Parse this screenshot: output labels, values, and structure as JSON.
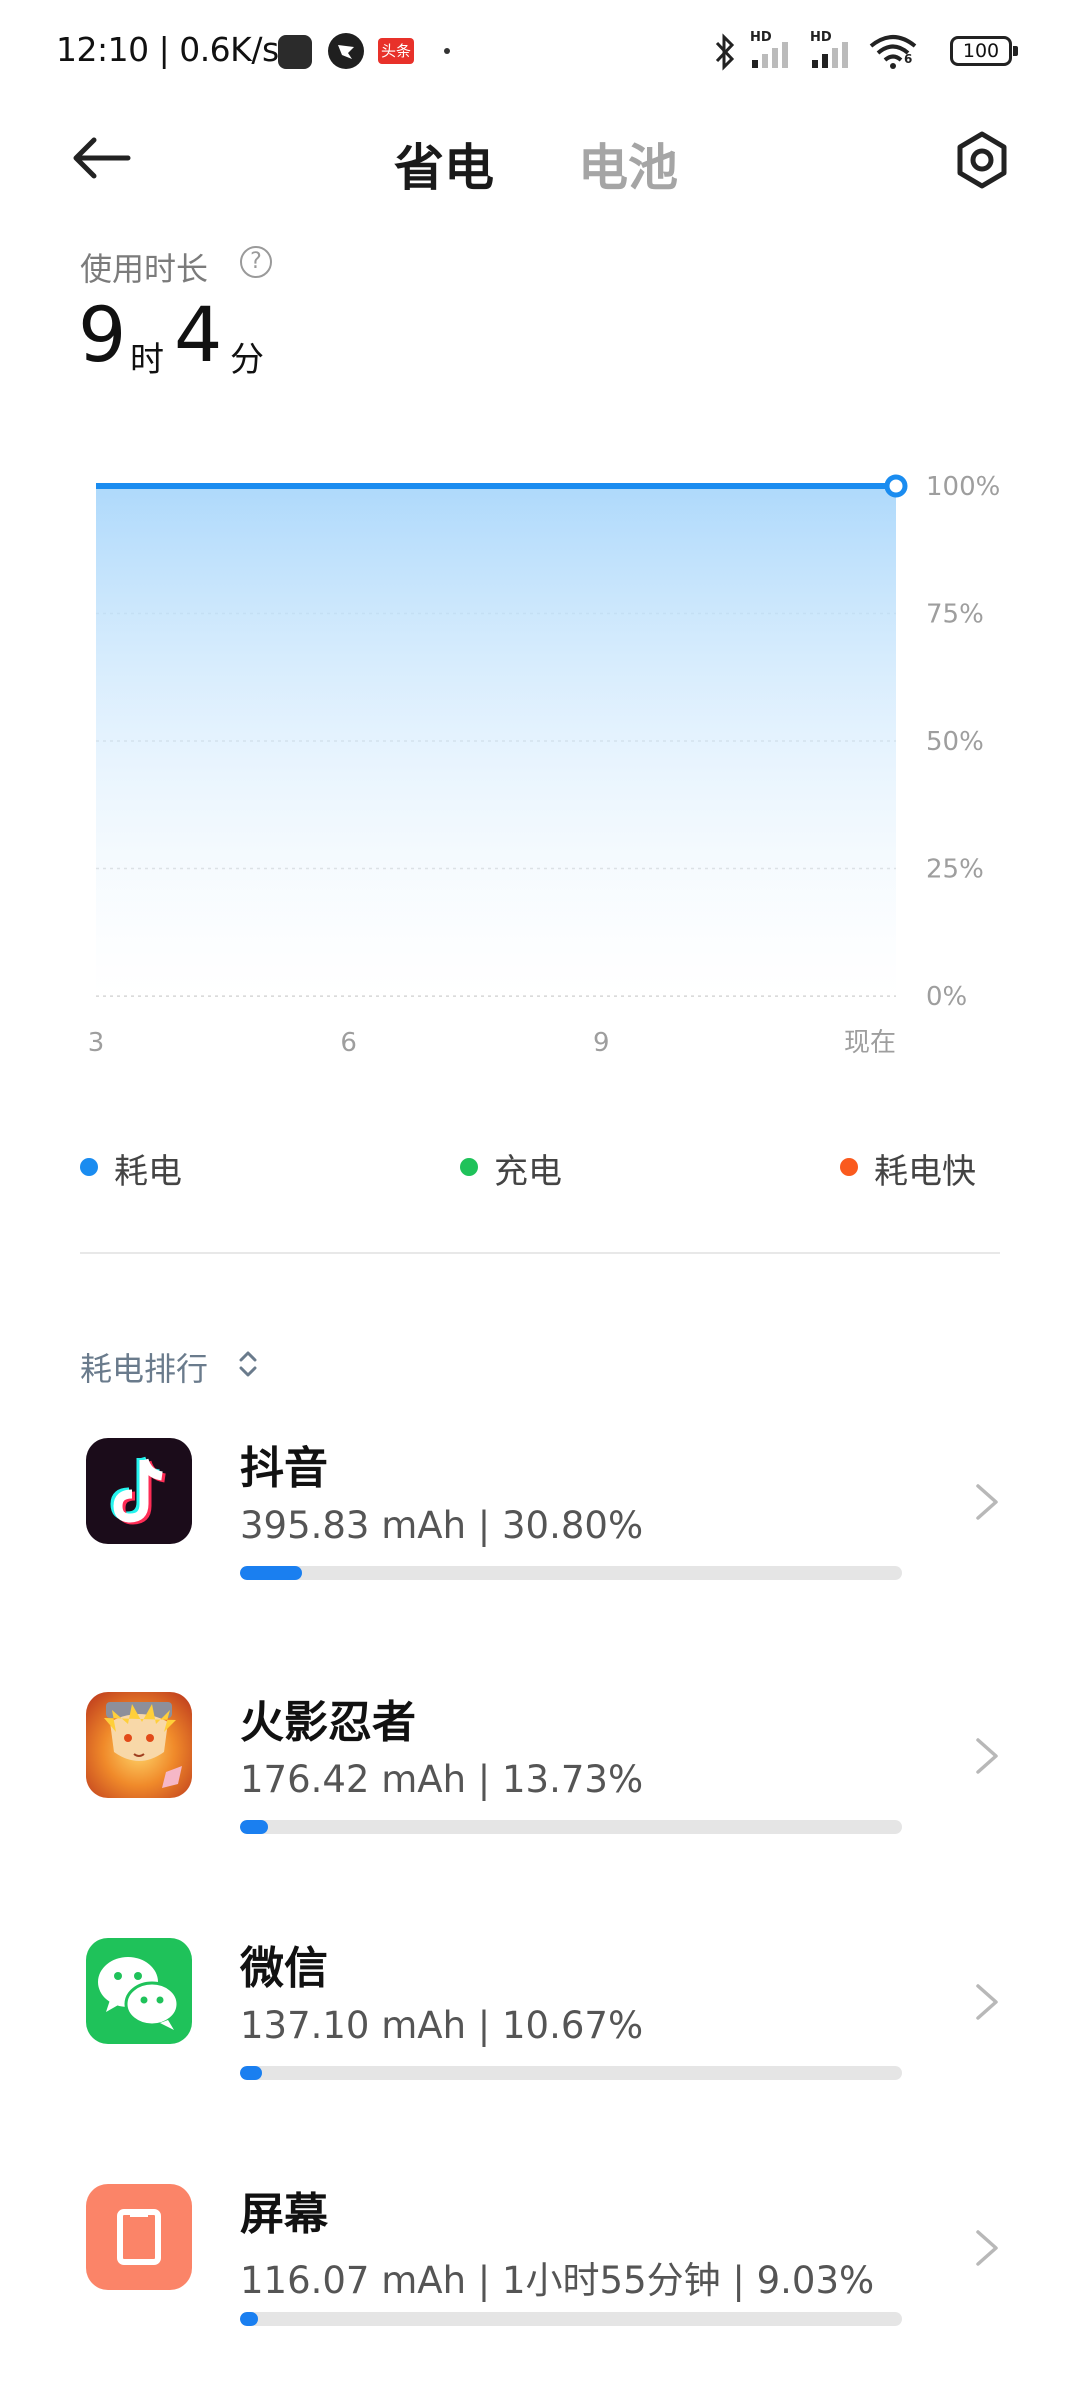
{
  "status_bar": {
    "time_speed": "12:10 | 0.6K/s",
    "toutiao_badge": "头条",
    "signal1_label": "HD",
    "signal2_label": "HD",
    "wifi_label": "6",
    "battery_level": "100"
  },
  "header": {
    "tab_power_saving": "省电",
    "tab_battery": "电池"
  },
  "usage": {
    "label": "使用时长",
    "help": "?",
    "hours": "9",
    "hours_unit": "时",
    "minutes": "4",
    "minutes_unit": "分"
  },
  "chart_data": {
    "type": "area",
    "x_ticks": [
      "3",
      "6",
      "9",
      "现在"
    ],
    "y_ticks": [
      "100%",
      "75%",
      "50%",
      "25%",
      "0%"
    ],
    "ylim": [
      0,
      100
    ],
    "series": [
      {
        "x": [
          3,
          12.5
        ],
        "values": [
          100,
          100
        ]
      }
    ],
    "colors": {
      "line": "#1a8cf0",
      "fill_top": "#aed9fb"
    }
  },
  "legend": [
    {
      "label": "耗电",
      "color": "#1a8cf0"
    },
    {
      "label": "充电",
      "color": "#1fc25a"
    },
    {
      "label": "耗电快",
      "color": "#fa5a1e"
    }
  ],
  "ranking": {
    "title": "耗电排行",
    "apps": [
      {
        "name": "抖音",
        "stats": "395.83 mAh | 30.80%",
        "percent": 30.8,
        "icon": "tiktok-icon"
      },
      {
        "name": "火影忍者",
        "stats": "176.42 mAh | 13.73%",
        "percent": 13.73,
        "icon": "naruto-icon"
      },
      {
        "name": "微信",
        "stats": "137.10 mAh | 10.67%",
        "percent": 10.67,
        "icon": "wechat-icon"
      },
      {
        "name": "屏幕",
        "stats": "116.07 mAh | 1小时55分钟 | 9.03%",
        "percent": 9.03,
        "icon": "screen-icon"
      }
    ]
  }
}
